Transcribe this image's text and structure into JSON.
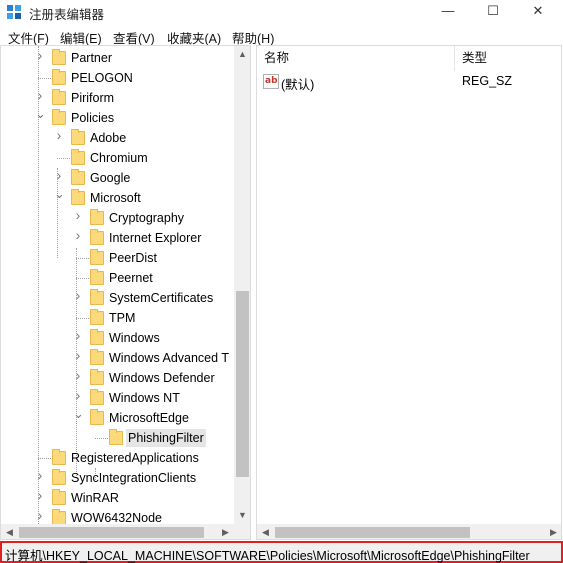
{
  "window": {
    "title": "注册表编辑器",
    "controls": {
      "minimize": "—",
      "maximize": "☐",
      "close": "✕"
    }
  },
  "menu": {
    "file": "文件(F)",
    "edit": "编辑(E)",
    "view": "查看(V)",
    "favorites": "收藏夹(A)",
    "help": "帮助(H)"
  },
  "tree": {
    "items": [
      {
        "label": "Partner",
        "expander": "collapsed"
      },
      {
        "label": "PELOGON",
        "expander": "none"
      },
      {
        "label": "Piriform",
        "expander": "collapsed"
      },
      {
        "label": "Policies",
        "expander": "expanded"
      },
      {
        "label": "Adobe",
        "expander": "collapsed"
      },
      {
        "label": "Chromium",
        "expander": "none"
      },
      {
        "label": "Google",
        "expander": "collapsed"
      },
      {
        "label": "Microsoft",
        "expander": "expanded"
      },
      {
        "label": "Cryptography",
        "expander": "collapsed"
      },
      {
        "label": "Internet Explorer",
        "expander": "collapsed"
      },
      {
        "label": "PeerDist",
        "expander": "none"
      },
      {
        "label": "Peernet",
        "expander": "none"
      },
      {
        "label": "SystemCertificates",
        "expander": "collapsed"
      },
      {
        "label": "TPM",
        "expander": "none"
      },
      {
        "label": "Windows",
        "expander": "collapsed"
      },
      {
        "label": "Windows Advanced T",
        "expander": "collapsed"
      },
      {
        "label": "Windows Defender",
        "expander": "collapsed"
      },
      {
        "label": "Windows NT",
        "expander": "collapsed"
      },
      {
        "label": "MicrosoftEdge",
        "expander": "expanded"
      },
      {
        "label": "PhishingFilter",
        "expander": "none",
        "selected": true
      },
      {
        "label": "RegisteredApplications",
        "expander": "none"
      },
      {
        "label": "SyncIntegrationClients",
        "expander": "collapsed"
      },
      {
        "label": "WinRAR",
        "expander": "collapsed"
      },
      {
        "label": "WOW6432Node",
        "expander": "collapsed"
      }
    ]
  },
  "list": {
    "columns": {
      "name": "名称",
      "type": "类型"
    },
    "rows": [
      {
        "name": "(默认)",
        "type": "REG_SZ",
        "icon": "string-value-icon",
        "icon_text": "ab"
      }
    ]
  },
  "statusbar": {
    "path": "计算机\\HKEY_LOCAL_MACHINE\\SOFTWARE\\Policies\\Microsoft\\MicrosoftEdge\\PhishingFilter"
  },
  "colors": {
    "folder": "#fcd97a",
    "selection": "#e5e5e5",
    "highlight_border": "#e02020"
  }
}
